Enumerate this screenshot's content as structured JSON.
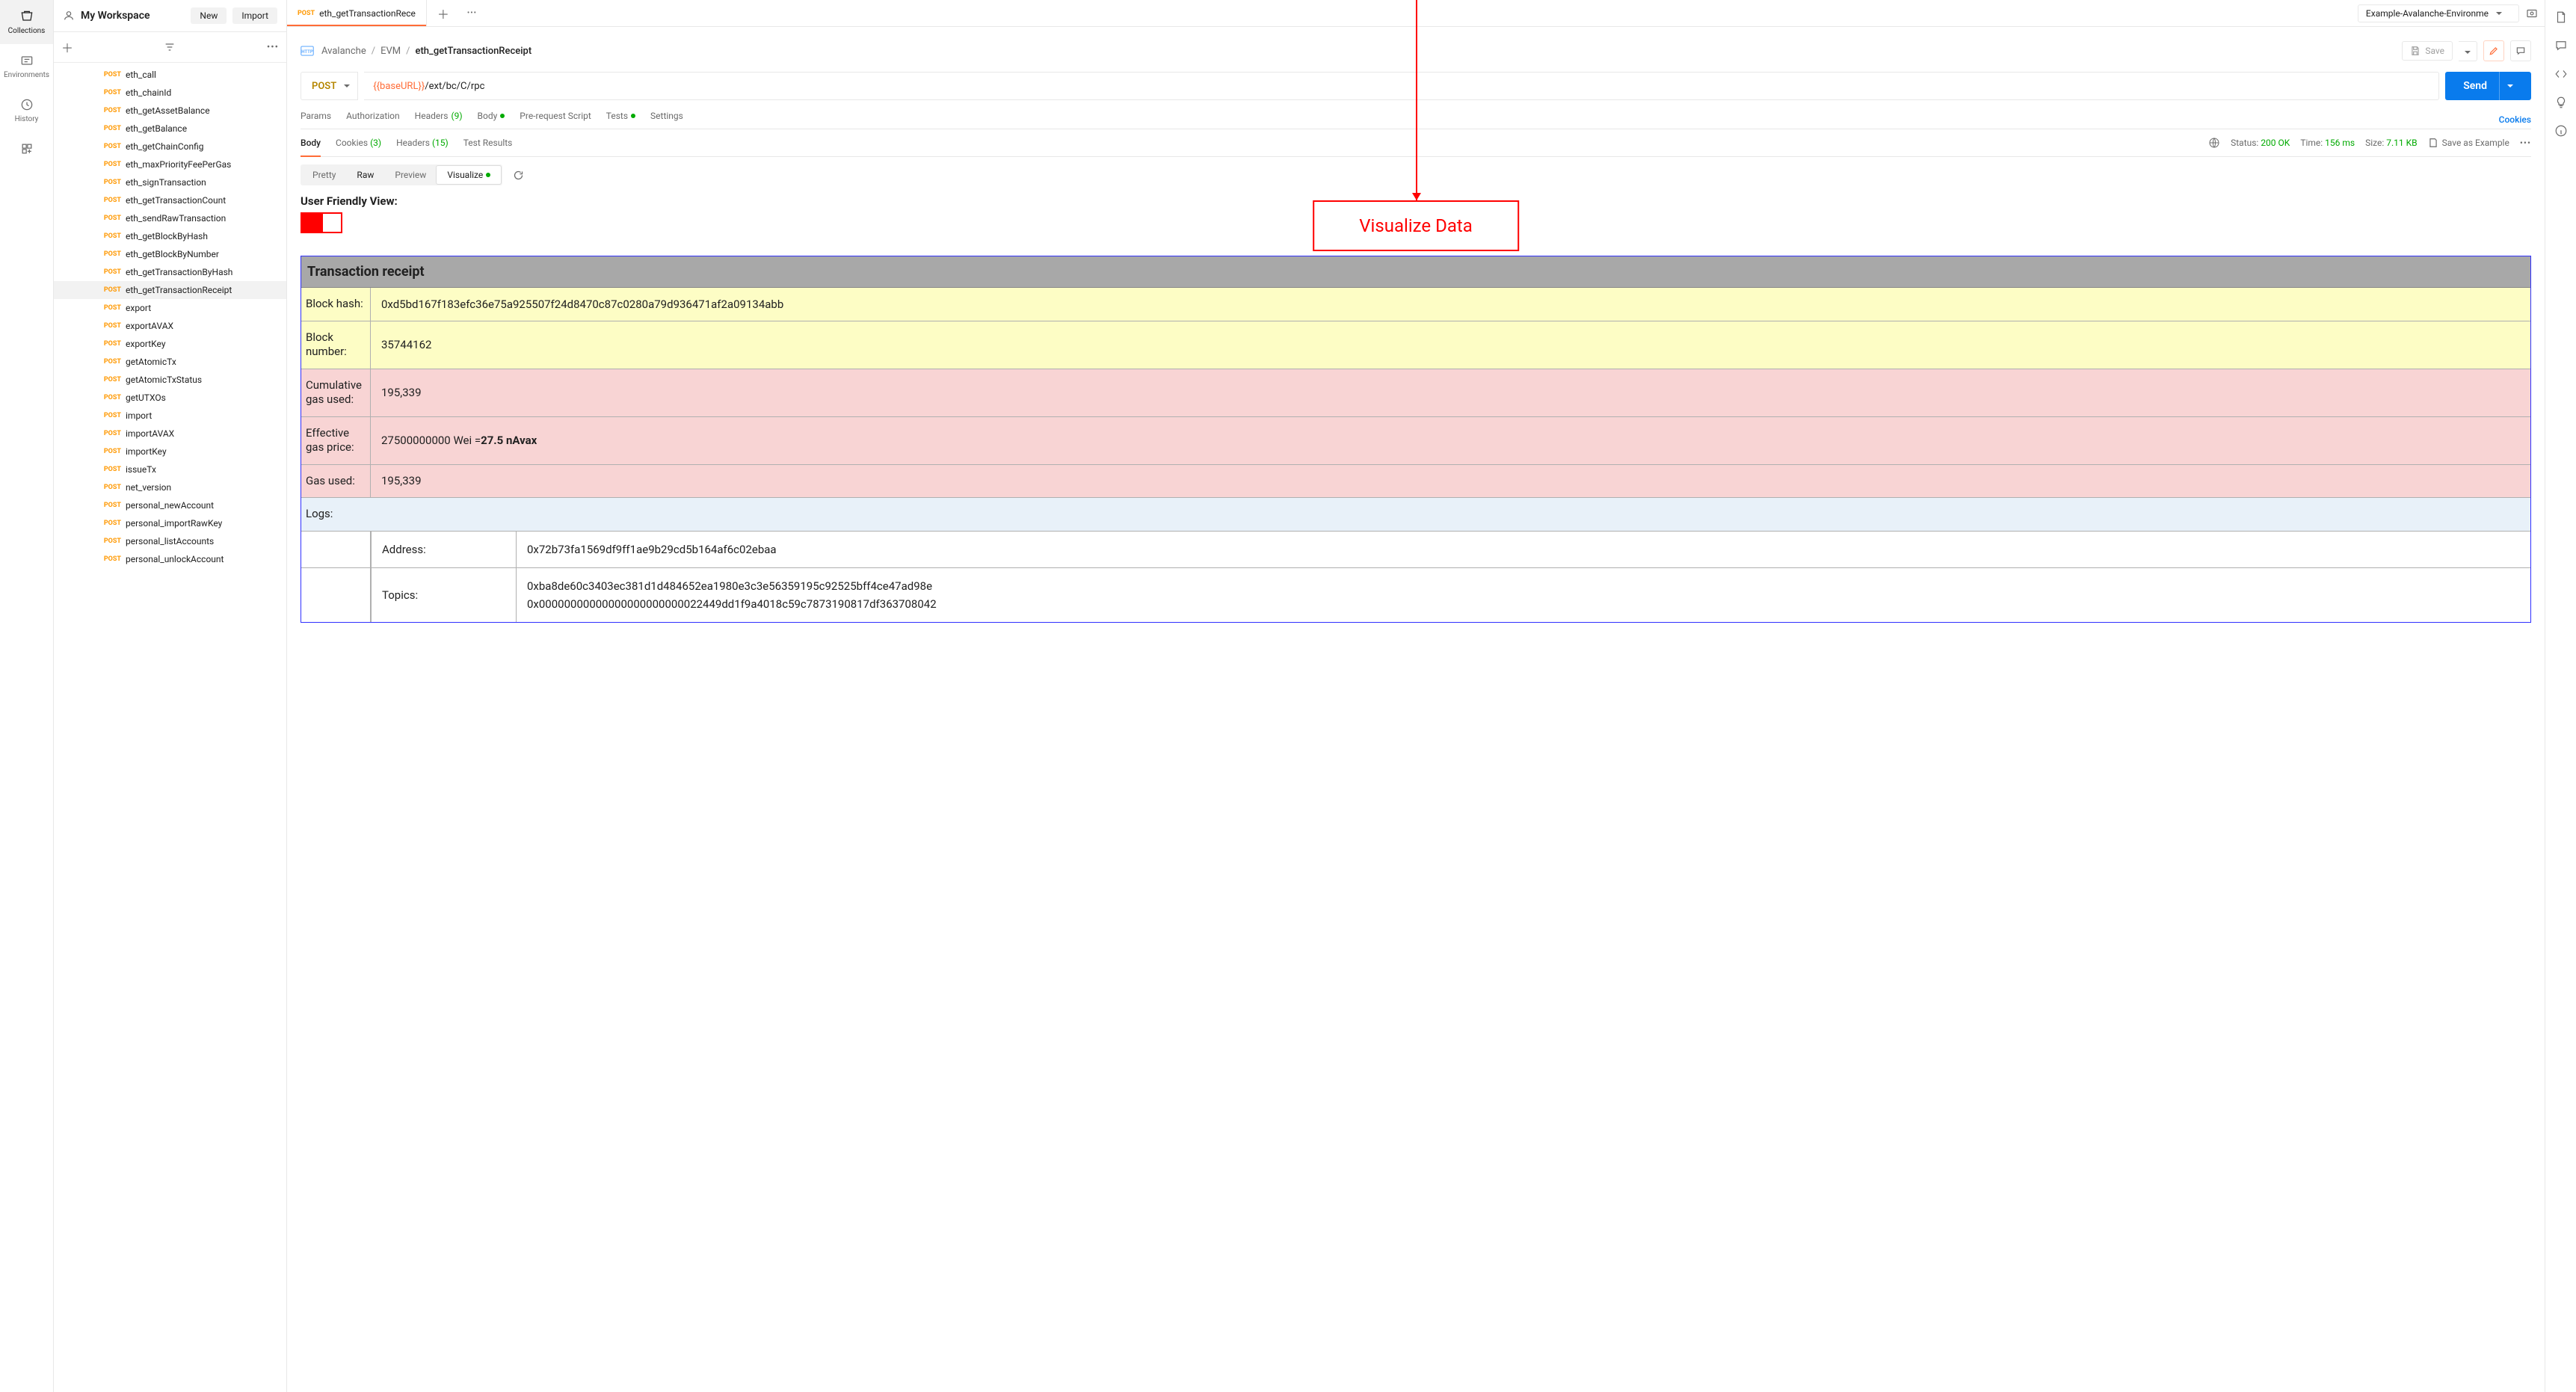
{
  "workspace": {
    "title": "My Workspace",
    "new_btn": "New",
    "import_btn": "Import"
  },
  "rail": {
    "collections": "Collections",
    "environments": "Environments",
    "history": "History"
  },
  "tree": [
    {
      "m": "POST",
      "name": "eth_call"
    },
    {
      "m": "POST",
      "name": "eth_chainId"
    },
    {
      "m": "POST",
      "name": "eth_getAssetBalance"
    },
    {
      "m": "POST",
      "name": "eth_getBalance"
    },
    {
      "m": "POST",
      "name": "eth_getChainConfig"
    },
    {
      "m": "POST",
      "name": "eth_maxPriorityFeePerGas"
    },
    {
      "m": "POST",
      "name": "eth_signTransaction"
    },
    {
      "m": "POST",
      "name": "eth_getTransactionCount"
    },
    {
      "m": "POST",
      "name": "eth_sendRawTransaction"
    },
    {
      "m": "POST",
      "name": "eth_getBlockByHash"
    },
    {
      "m": "POST",
      "name": "eth_getBlockByNumber"
    },
    {
      "m": "POST",
      "name": "eth_getTransactionByHash"
    },
    {
      "m": "POST",
      "name": "eth_getTransactionReceipt",
      "sel": true
    },
    {
      "m": "POST",
      "name": "export"
    },
    {
      "m": "POST",
      "name": "exportAVAX"
    },
    {
      "m": "POST",
      "name": "exportKey"
    },
    {
      "m": "POST",
      "name": "getAtomicTx"
    },
    {
      "m": "POST",
      "name": "getAtomicTxStatus"
    },
    {
      "m": "POST",
      "name": "getUTXOs"
    },
    {
      "m": "POST",
      "name": "import"
    },
    {
      "m": "POST",
      "name": "importAVAX"
    },
    {
      "m": "POST",
      "name": "importKey"
    },
    {
      "m": "POST",
      "name": "issueTx"
    },
    {
      "m": "POST",
      "name": "net_version"
    },
    {
      "m": "POST",
      "name": "personal_newAccount"
    },
    {
      "m": "POST",
      "name": "personal_importRawKey"
    },
    {
      "m": "POST",
      "name": "personal_listAccounts"
    },
    {
      "m": "POST",
      "name": "personal_unlockAccount"
    }
  ],
  "tab": {
    "method": "POST",
    "title": "eth_getTransactionRece"
  },
  "env": {
    "name": "Example-Avalanche-Environme"
  },
  "breadcrumb": {
    "a": "Avalanche",
    "b": "EVM",
    "c": "eth_getTransactionReceipt",
    "save": "Save"
  },
  "url": {
    "method": "POST",
    "var": "{{baseURL}}",
    "rest": "/ext/bc/C/rpc",
    "send": "Send"
  },
  "rtabs": {
    "params": "Params",
    "auth": "Authorization",
    "headers": "Headers",
    "headers_count": "(9)",
    "body": "Body",
    "prereq": "Pre-request Script",
    "tests": "Tests",
    "settings": "Settings",
    "cookies": "Cookies"
  },
  "resptabs": {
    "body": "Body",
    "cookies": "Cookies",
    "cookies_count": "(3)",
    "headers": "Headers",
    "headers_count": "(15)",
    "test_results": "Test Results"
  },
  "meta": {
    "status_l": "Status:",
    "status_v": "200 OK",
    "time_l": "Time:",
    "time_v": "156 ms",
    "size_l": "Size:",
    "size_v": "7.11 KB",
    "save_ex": "Save as Example"
  },
  "views": {
    "pretty": "Pretty",
    "raw": "Raw",
    "preview": "Preview",
    "visualize": "Visualize"
  },
  "ufv": "User Friendly View:",
  "annotation": "Visualize Data",
  "table": {
    "header": "Transaction receipt",
    "rows": [
      {
        "k": "Block hash:",
        "v": "0xd5bd167f183efc36e75a925507f24d8470c87c0280a79d936471af2a09134abb",
        "cls": "yellow"
      },
      {
        "k": "Block number:",
        "v": "35744162",
        "cls": "yellow"
      },
      {
        "k": "Cumulative gas used:",
        "v": "195,339",
        "cls": "pink"
      },
      {
        "k": "Effective gas price:",
        "v_pre": "27500000000 Wei = ",
        "v_bold": "27.5 nAvax",
        "cls": "pink"
      },
      {
        "k": "Gas used:",
        "v": "195,339",
        "cls": "pink"
      }
    ],
    "logs_label": "Logs:",
    "log": {
      "address_l": "Address:",
      "address_v": "0x72b73fa1569df9ff1ae9b29cd5b164af6c02ebaa",
      "topics_l": "Topics:",
      "topics_v1": "0xba8de60c3403ec381d1d484652ea1980e3c3e56359195c92525bff4ce47ad98e",
      "topics_v2": "0x00000000000000000000000022449dd1f9a4018c59c7873190817df363708042"
    }
  }
}
